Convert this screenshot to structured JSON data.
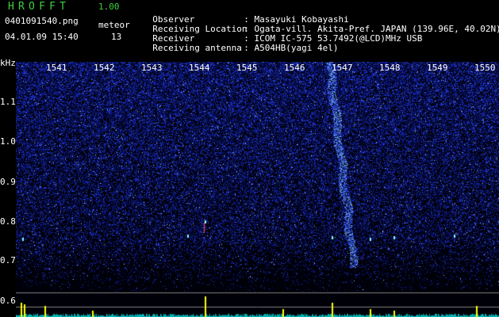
{
  "header": {
    "app_title": "HROFFT",
    "version": "1.00",
    "filename": "0401091540.png",
    "datetime": "04.01.09 15:40",
    "mode_label": "meteor",
    "count": "13"
  },
  "info": {
    "rows": [
      {
        "label": "Observer",
        "value": ": Masayuki Kobayashi"
      },
      {
        "label": "Receiving Location",
        "value": ": Ogata-vill. Akita-Pref. JAPAN (139.96E, 40.02N)"
      },
      {
        "label": "Receiver",
        "value": ": ICOM IC-575 53.7492(@LCD)MHz USB"
      },
      {
        "label": "Receiving antenna",
        "value": ": A504HB(yagi 4el)"
      }
    ]
  },
  "spectrogram": {
    "y_unit": "kHz",
    "x_ticks": [
      "1541",
      "1542",
      "1543",
      "1544",
      "1545",
      "1546",
      "1547",
      "1548",
      "1549",
      "1550"
    ],
    "y_ticks": [
      "1.1",
      "1.0",
      "0.9",
      "0.8",
      "0.7",
      "0.6"
    ],
    "colors": {
      "background": "#000008",
      "noise": "#1a3cff",
      "signal": "#80ffff",
      "amplitude": "#ffff00",
      "baseline": "#00ffff"
    }
  }
}
